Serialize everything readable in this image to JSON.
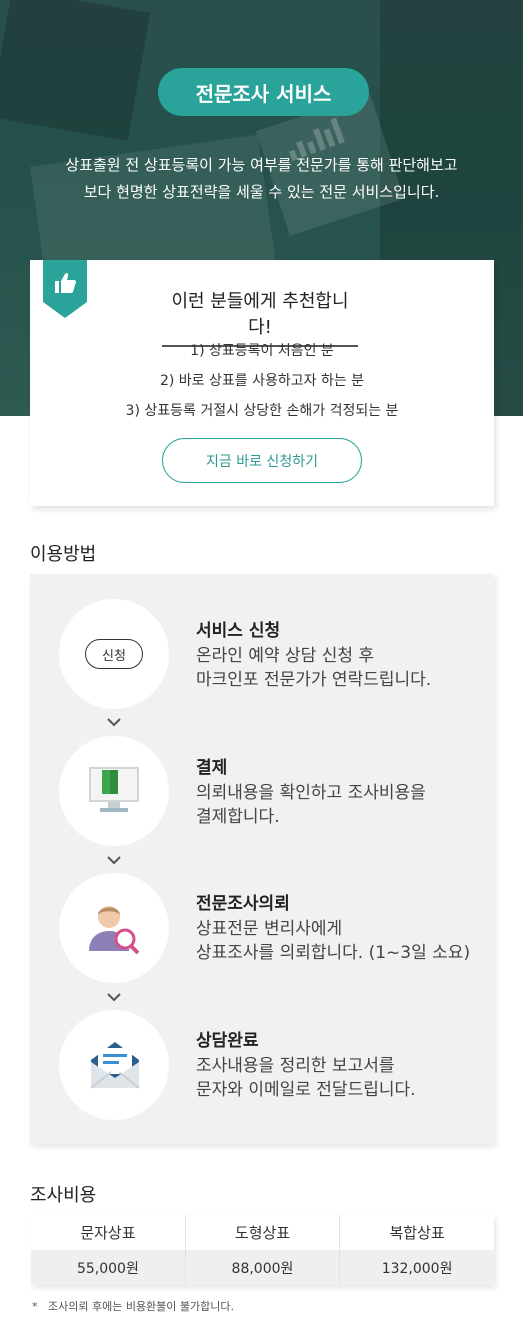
{
  "hero": {
    "pill": "전문조사 서비스",
    "desc_line1": "상표출원 전 상표등록이 가능 여부를 전문가를 통해 판단해보고",
    "desc_line2": "보다 현명한 상표전략을 세울 수 있는 전문 서비스입니다."
  },
  "recommend": {
    "title": "이런 분들에게 추천합니다!",
    "items": [
      "1) 상표등록이 처음인 분",
      "2) 바로 상표를 사용하고자 하는 분",
      "3) 상표등록 거절시 상당한 손해가 걱정되는 분"
    ],
    "button": "지금 바로 신청하기"
  },
  "usage": {
    "title": "이용방법",
    "steps": [
      {
        "icon": "apply-chip",
        "chip": "신청",
        "title": "서비스 신청",
        "desc1": "온라인 예약 상담 신청 후",
        "desc2": "마크인포 전문가가 연락드립니다."
      },
      {
        "icon": "payment-monitor-icon",
        "title": "결제",
        "desc1": "의뢰내용을 확인하고 조사비용을",
        "desc2": "결제합니다."
      },
      {
        "icon": "attorney-search-icon",
        "title": "전문조사의뢰",
        "desc1": "상표전문 변리사에게",
        "desc2": "상표조사를 의뢰합니다. (1~3일 소요)"
      },
      {
        "icon": "mail-envelope-icon",
        "title": "상담완료",
        "desc1": "조사내용을 정리한 보고서를",
        "desc2": "문자와 이메일로 전달드립니다."
      }
    ]
  },
  "fees": {
    "title": "조사비용",
    "headers": [
      "문자상표",
      "도형상표",
      "복합상표"
    ],
    "values": [
      "55,000원",
      "88,000원",
      "132,000원"
    ],
    "note": "*   조사의뢰 후에는 비용환불이 불가합니다."
  },
  "colors": {
    "accent": "#2aa39a",
    "hero_bg": "#2b4f4c",
    "panel_bg": "#f1f1f1"
  }
}
